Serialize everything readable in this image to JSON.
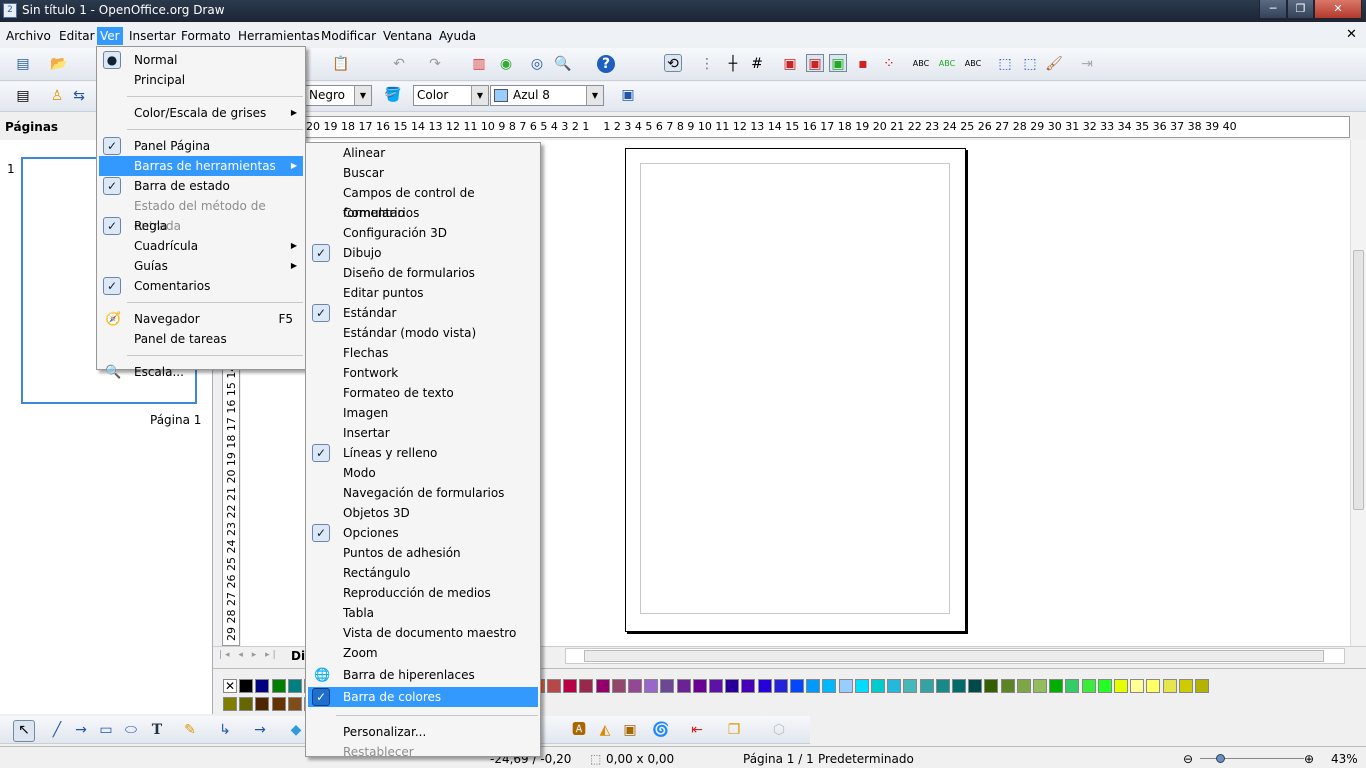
{
  "window": {
    "title": "Sin título 1 - OpenOffice.org Draw",
    "controls": [
      "─",
      "❐",
      "✕"
    ]
  },
  "menubar": [
    "Archivo",
    "Editar",
    "Ver",
    "Insertar",
    "Formato",
    "Herramientas",
    "Modificar",
    "Ventana",
    "Ayuda"
  ],
  "active_menu": "Ver",
  "toolbar2": {
    "line_color": "Negro",
    "area_style": "Color",
    "area_color": "Azul 8",
    "area_swatch": "#99ccff"
  },
  "sidebar": {
    "title": "Páginas",
    "page_number": "1",
    "page_label": "Página 1"
  },
  "hruler": "20 19 18 17 16 15 14 13 12 11 10 9 8 7 6 5 4 3 2 1    1 2 3 4 5 6 7 8 9 10 11 12 13 14 15 16 17 18 19 20 21 22 23 24 25 26 27 28 29 30 31 32 33 34 35 36 37 38 39 40",
  "vruler": "29 28 27 26 25 24 23 22 21 20 19 18 17 16 15 14 13",
  "tab_label": "Di",
  "ver_menu": [
    {
      "label": "Normal",
      "mark": "radio"
    },
    {
      "label": "Principal"
    },
    {
      "sep": true
    },
    {
      "label": "Color/Escala de grises",
      "submenu": true
    },
    {
      "sep": true
    },
    {
      "label": "Panel Página",
      "mark": "check"
    },
    {
      "label": "Barras de herramientas",
      "submenu": true,
      "highlighted": true
    },
    {
      "label": "Barra de estado",
      "mark": "check"
    },
    {
      "label": "Estado del método de entrada",
      "disabled": true
    },
    {
      "label": "Regla",
      "mark": "check"
    },
    {
      "label": "Cuadrícula",
      "submenu": true
    },
    {
      "label": "Guías",
      "submenu": true
    },
    {
      "label": "Comentarios",
      "mark": "check"
    },
    {
      "sep": true
    },
    {
      "label": "Navegador",
      "shortcut": "F5",
      "icon": "navigator-icon"
    },
    {
      "label": "Panel de tareas"
    },
    {
      "sep": true
    },
    {
      "label": "Escala...",
      "icon": "zoom-icon"
    }
  ],
  "toolbars_submenu": [
    {
      "label": "Alinear"
    },
    {
      "label": "Buscar"
    },
    {
      "label": "Campos de control de formulario"
    },
    {
      "label": "Comentarios"
    },
    {
      "label": "Configuración 3D"
    },
    {
      "label": "Dibujo",
      "mark": "check"
    },
    {
      "label": "Diseño de formularios"
    },
    {
      "label": "Editar puntos"
    },
    {
      "label": "Estándar",
      "mark": "check"
    },
    {
      "label": "Estándar (modo vista)"
    },
    {
      "label": "Flechas"
    },
    {
      "label": "Fontwork"
    },
    {
      "label": "Formateo de texto"
    },
    {
      "label": "Imagen"
    },
    {
      "label": "Insertar"
    },
    {
      "label": "Líneas y relleno",
      "mark": "check"
    },
    {
      "label": "Modo"
    },
    {
      "label": "Navegación de formularios"
    },
    {
      "label": "Objetos 3D"
    },
    {
      "label": "Opciones",
      "mark": "check"
    },
    {
      "label": "Puntos de adhesión"
    },
    {
      "label": "Rectángulo"
    },
    {
      "label": "Reproducción de medios"
    },
    {
      "label": "Tabla"
    },
    {
      "label": "Vista de documento maestro"
    },
    {
      "label": "Zoom"
    },
    {
      "label": "Barra de hiperenlaces",
      "icon": "hyperlink-icon"
    },
    {
      "label": "Barra de colores",
      "mark": "check",
      "highlighted": true
    },
    {
      "sep": true
    },
    {
      "label": "Personalizar..."
    },
    {
      "label": "Restablecer",
      "disabled": true
    }
  ],
  "palette_row1": [
    "none",
    "#000000",
    "#000080",
    "#008000",
    "#008080",
    "#800000",
    "#800080",
    "#808000",
    "#808080",
    "#666666",
    "#999999",
    "#b2b2b2",
    "#cccccc",
    "#dddddd",
    "#eeeeff",
    "#ff3366",
    "#dc2300",
    "#b84700",
    "#ff3333",
    "#eb613d",
    "#b84747",
    "#b80047",
    "#99284c",
    "#94006b",
    "#94476b",
    "#944794",
    "#9966cc",
    "#6b4794",
    "#6b2394",
    "#6b0094",
    "#5e11a6",
    "#280099",
    "#4700b8",
    "#2300dc",
    "#2323dc",
    "#0047ff",
    "#0099ff",
    "#00b8ff",
    "#99ccff",
    "#00dcff",
    "#00cccc",
    "#23b8dc",
    "#47b8b8",
    "#33a3a3",
    "#198a8a",
    "#006b6b",
    "#004a4a",
    "#355e00",
    "#5c8526",
    "#7da647",
    "#94bd5e",
    "#00ae00",
    "#33cc66",
    "#3deb3d",
    "#23ff23",
    "#e6ff00",
    "#ffff99",
    "#ffff66",
    "#e6e64c",
    "#cccc00",
    "#b3b300"
  ],
  "palette_row2": [
    "#808000",
    "#666600",
    "#4d2600",
    "#663300",
    "#804d1a",
    "#996633",
    "#b38040",
    "#cc9955",
    "#e6b36b",
    "#ffcc80",
    "#4a8c1c",
    "#7a0020",
    "#8fc8f5",
    "#333d0f",
    "#a8c600",
    "#4b2680",
    "#ff950e",
    "#c5000b",
    "#0084d1"
  ],
  "status": {
    "position": "-24,69 / -0,20",
    "size": "0,00 x 0,00",
    "page": "Página 1 / 1",
    "style": "Predeterminado",
    "zoom": "43%",
    "zoom_level_percent": 43
  }
}
